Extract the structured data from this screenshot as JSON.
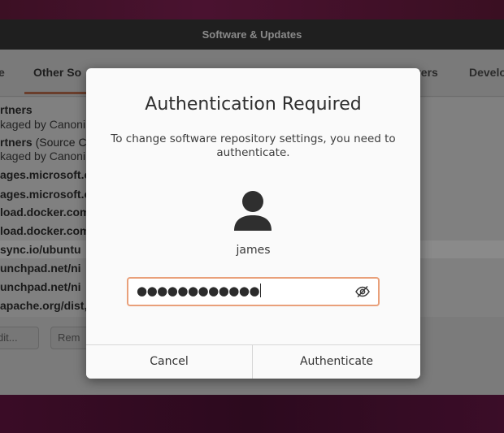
{
  "background_window": {
    "title": "Software & Updates",
    "tabs": [
      {
        "label": "e"
      },
      {
        "label": "Other So"
      },
      {
        "label": "vers"
      },
      {
        "label": "Develo"
      }
    ],
    "repo_lines": [
      {
        "text": "rtners",
        "bold": true
      },
      {
        "text": "kaged by Canoni",
        "bold": false
      },
      {
        "text_bold": "rtners",
        "text_rest": " (Source C",
        "bold": true
      },
      {
        "text": "kaged by Canoni",
        "bold": false
      },
      {
        "text": "ages.microsoft.c",
        "bold": true
      },
      {
        "text": "ages.microsoft.c",
        "bold": true
      },
      {
        "text": "load.docker.com",
        "bold": true
      },
      {
        "text": "load.docker.com",
        "bold": true
      },
      {
        "text": "sync.io/ubuntu",
        "bold": true
      },
      {
        "text": "unchpad.net/ni",
        "bold": true
      },
      {
        "text": "unchpad.net/ni",
        "bold": true
      },
      {
        "text": "apache.org/dist,",
        "bold": true
      }
    ],
    "buttons": {
      "edit": "dit...",
      "remove": "Rem"
    }
  },
  "dialog": {
    "title": "Authentication Required",
    "message": "To change software repository settings, you need to authenticate.",
    "avatar_icon": "user-avatar-icon",
    "username": "james",
    "password_masked": "●●●●●●●●●●●●",
    "reveal_icon": "eye-slash-icon",
    "cancel_label": "Cancel",
    "authenticate_label": "Authenticate",
    "focus_color": "#e9a07a"
  }
}
